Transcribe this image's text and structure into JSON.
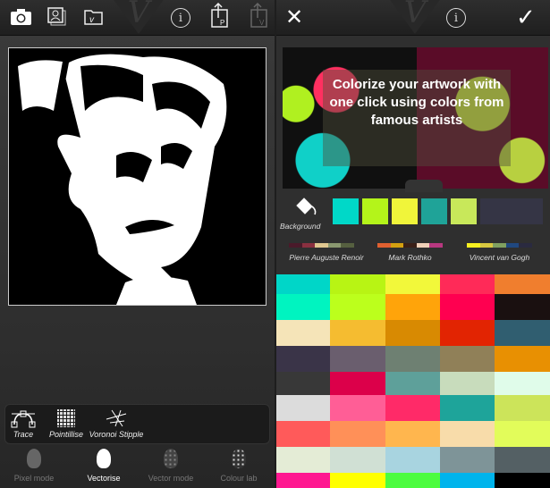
{
  "left_toolbar": {
    "icons": [
      "camera-icon",
      "photo-library-icon",
      "project-folder-icon",
      "info-icon",
      "export-project-icon",
      "export-vector-icon"
    ],
    "info_label": "i",
    "export_p": "P",
    "export_v": "V"
  },
  "left_tools": [
    {
      "label": "Trace"
    },
    {
      "label": "Pointillise"
    },
    {
      "label": "Voronoi Stipple"
    }
  ],
  "modes": [
    {
      "label": "Pixel mode",
      "active": false
    },
    {
      "label": "Vectorise",
      "active": true
    },
    {
      "label": "Vector mode",
      "active": false
    },
    {
      "label": "Colour lab",
      "active": false
    }
  ],
  "right_toolbar": {
    "close": "✕",
    "info": "i",
    "confirm": "✓"
  },
  "banner": {
    "text": "Colorize your artwork with one click using colors from famous artists"
  },
  "background": {
    "label": "Background",
    "swatches": [
      "#00d8c8",
      "#b4f41a",
      "#f0f53a",
      "#1fa398",
      "#c8e85a"
    ],
    "bg_color": "#353545"
  },
  "artists": [
    {
      "name": "Pierre Auguste Renoir",
      "colors": [
        "#4a1a2a",
        "#8a3040",
        "#e0c890",
        "#8a9870",
        "#566040"
      ]
    },
    {
      "name": "Mark Rothko",
      "colors": [
        "#e06030",
        "#d4a010",
        "#3a2018",
        "#f0d0b8",
        "#b83880"
      ]
    },
    {
      "name": "Vincent van Gogh",
      "colors": [
        "#f8f020",
        "#d8c840",
        "#80a060",
        "#204880",
        "#2a2a40"
      ]
    }
  ],
  "palette_grid": [
    [
      "#00d6c8",
      "#b8f414",
      "#f2f83a",
      "#ff2a58",
      "#f07e2e"
    ],
    [
      "#00f4c0",
      "#bcff1c",
      "#ffa40a",
      "#ff0050",
      "#1a1010"
    ],
    [
      "#f5e4b8",
      "#f5bc30",
      "#d88a02",
      "#e22402",
      "#305e70"
    ],
    [
      "#3a3448",
      "#6a5e6e",
      "#6e8072",
      "#908058",
      "#e89002"
    ],
    [
      "#383838",
      "#dc004a",
      "#5ea09a",
      "#c8dcbc",
      "#e0fcea"
    ],
    [
      "#dcdcdc",
      "#ff5e96",
      "#ff2a68",
      "#1ea49a",
      "#cce45a"
    ],
    [
      "#ff5a5a",
      "#ff9058",
      "#ffb64e",
      "#f8dcaa",
      "#e2fc5a"
    ],
    [
      "#e4ecd6",
      "#d0e0d4",
      "#a8d4e0",
      "#7e9498",
      "#546064"
    ],
    [
      "#ff1890",
      "#ffff00",
      "#4cfc40",
      "#00b4ec",
      "#000000"
    ]
  ]
}
